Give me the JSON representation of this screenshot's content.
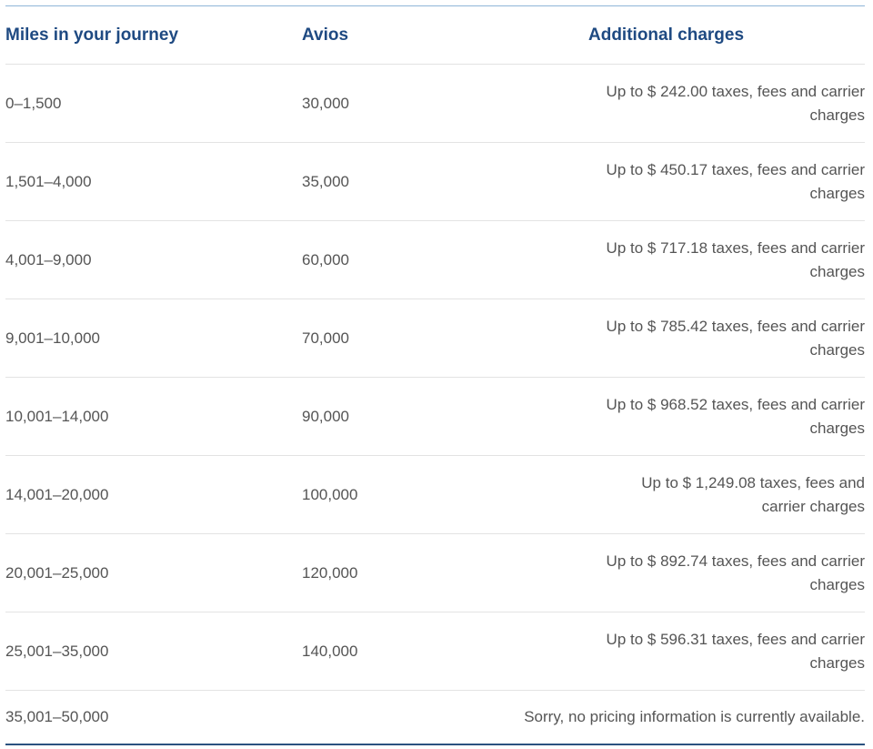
{
  "table": {
    "headers": {
      "miles": "Miles in your journey",
      "avios": "Avios",
      "charges": "Additional charges"
    },
    "rows": [
      {
        "miles": "0–1,500",
        "avios": "30,000",
        "charges": "Up to $ 242.00 taxes, fees and carrier charges"
      },
      {
        "miles": "1,501–4,000",
        "avios": "35,000",
        "charges": "Up to $ 450.17 taxes, fees and carrier charges"
      },
      {
        "miles": "4,001–9,000",
        "avios": "60,000",
        "charges": "Up to $ 717.18 taxes, fees and carrier charges"
      },
      {
        "miles": "9,001–10,000",
        "avios": "70,000",
        "charges": "Up to $ 785.42 taxes, fees and carrier charges"
      },
      {
        "miles": "10,001–14,000",
        "avios": "90,000",
        "charges": "Up to $ 968.52 taxes, fees and carrier charges"
      },
      {
        "miles": "14,001–20,000",
        "avios": "100,000",
        "charges": "Up to $ 1,249.08 taxes, fees and carrier charges"
      },
      {
        "miles": "20,001–25,000",
        "avios": "120,000",
        "charges": "Up to $ 892.74 taxes, fees and carrier charges"
      },
      {
        "miles": "25,001–35,000",
        "avios": "140,000",
        "charges": "Up to $ 596.31 taxes, fees and carrier charges"
      },
      {
        "miles": "35,001–50,000",
        "avios": "",
        "charges": "Sorry, no pricing information is currently available."
      }
    ]
  },
  "colors": {
    "header_text": "#1f4a82",
    "body_text": "#555555",
    "top_rule": "#8fb6d8",
    "bottom_rule": "#2b5280",
    "row_divider": "#e3e3e3"
  }
}
